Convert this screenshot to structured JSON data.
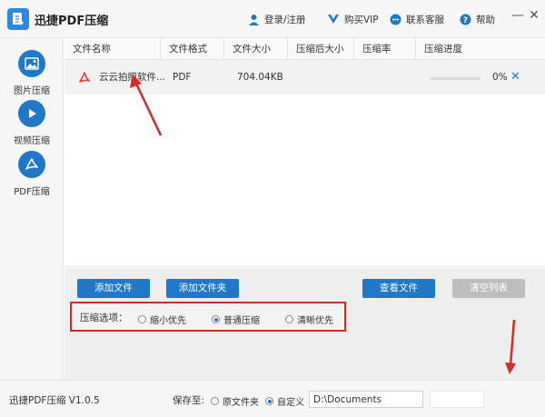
{
  "app": {
    "title": "迅捷PDF压缩",
    "login_label": "登录/注册",
    "vip_label": "购买VIP",
    "service_label": "联系客服",
    "help_label": "帮助",
    "window_minimize": "—",
    "window_close": "✕"
  },
  "sidebar": {
    "items": [
      {
        "label": "图片压缩",
        "icon": "image-icon"
      },
      {
        "label": "视频压缩",
        "icon": "play-icon"
      },
      {
        "label": "PDF压缩",
        "icon": "pdf-icon"
      }
    ]
  },
  "table": {
    "columns": [
      "文件名称",
      "文件格式",
      "文件大小",
      "压缩后大小",
      "压缩率",
      "压缩进度"
    ],
    "rows": [
      {
        "name": "云云拍照软件...",
        "format": "PDF",
        "size": "704.04KB",
        "compressed_size": "",
        "ratio": "",
        "progress": 0,
        "progress_text": "0%"
      }
    ]
  },
  "controls": {
    "add_file": "添加文件",
    "add_folder": "添加文件夹",
    "view_file": "查看文件",
    "clear_list": "清空列表",
    "options_title": "压缩选项：",
    "options": [
      {
        "label": "缩小优先",
        "selected": false
      },
      {
        "label": "普通压缩",
        "selected": true
      },
      {
        "label": "清晰优先",
        "selected": false
      }
    ]
  },
  "footer": {
    "version": "迅捷PDF压缩 V1.0.5",
    "save_to": "保存至:",
    "original_folder": "原文件夹",
    "custom": "自定义",
    "path": "D:\\Documents"
  },
  "colors": {
    "accent": "#1f78c8",
    "annotation": "#d42a2a",
    "pdf_red": "#e03c3c"
  }
}
